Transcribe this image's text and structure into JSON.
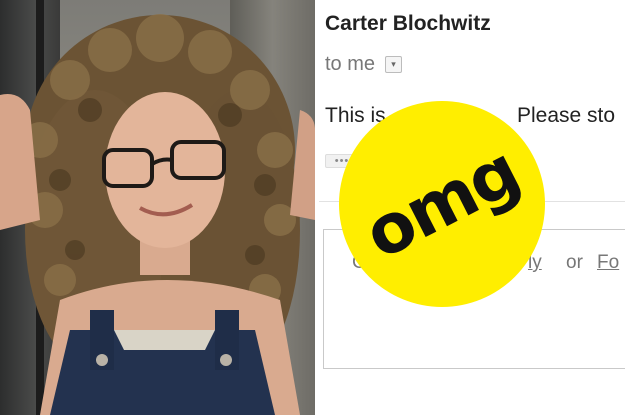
{
  "photo": {
    "description_icon": "person-photo"
  },
  "email": {
    "sender": "Carter Blochwitz",
    "recipient": "to me",
    "recipient_dropdown_icon": "▾",
    "body_visible_start": "This is",
    "body_visible_end": "Please sto",
    "trimmed_content_icon": "•••",
    "reply_prompt_start": "C",
    "reply_link_partial": "ly",
    "reply_or": "or",
    "forward_link_partial": "Fo"
  },
  "sticker": {
    "text": "omg",
    "color": "#ffee00"
  }
}
